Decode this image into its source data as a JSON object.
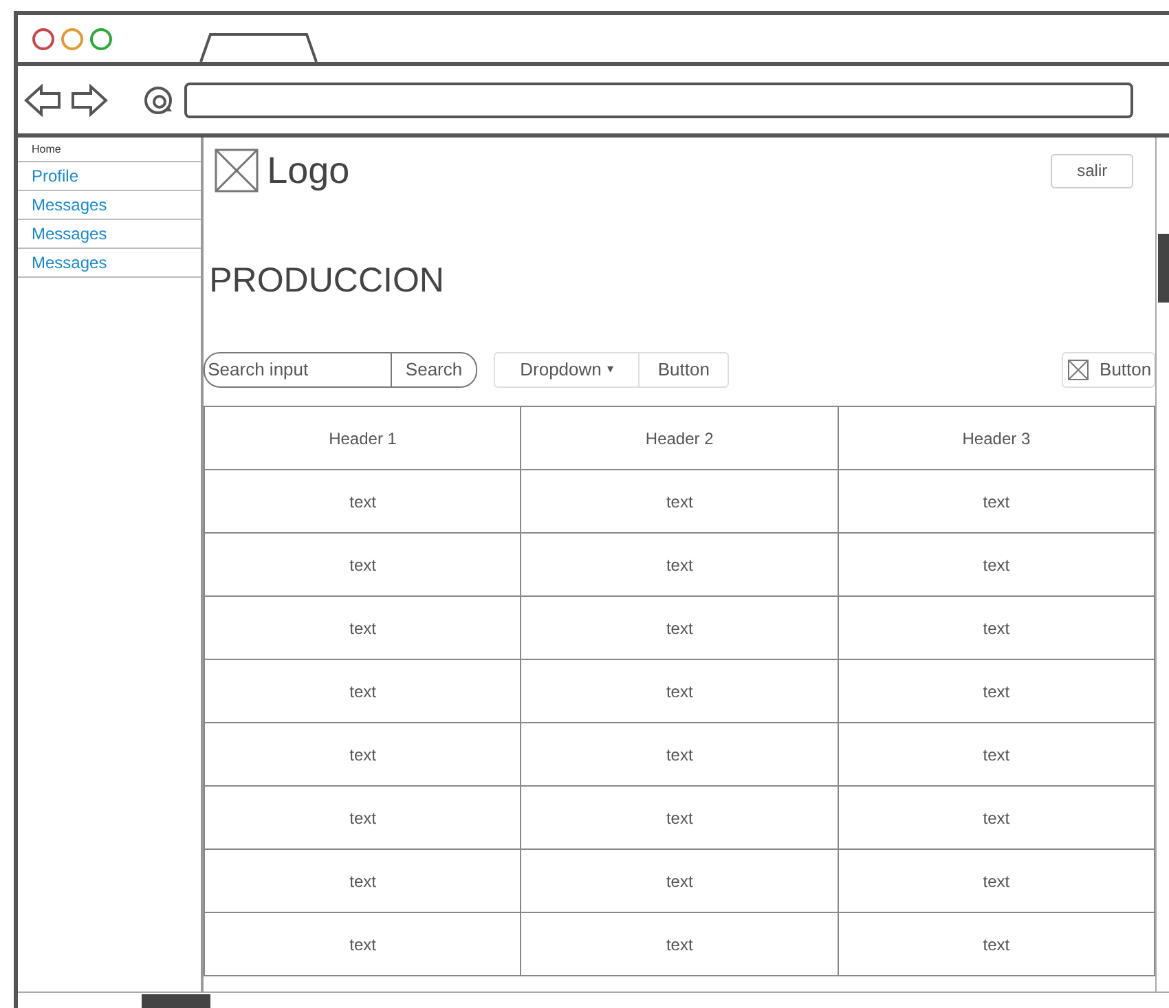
{
  "sidebar": {
    "items": [
      {
        "label": "Home",
        "kind": "header"
      },
      {
        "label": "Profile",
        "kind": "link"
      },
      {
        "label": "Messages",
        "kind": "link"
      },
      {
        "label": "Messages",
        "kind": "link"
      },
      {
        "label": "Messages",
        "kind": "link"
      }
    ]
  },
  "header": {
    "logo": "Logo",
    "exit_button": "salir"
  },
  "page_title": "PRODUCCION",
  "toolbar": {
    "search": {
      "placeholder": "Search input",
      "button": "Search"
    },
    "dropdown": "Dropdown",
    "dropdown_arrow": "▾",
    "button": "Button",
    "icon_button": "Button"
  },
  "table": {
    "columns": [
      "Header 1",
      "Header 2",
      "Header 3"
    ],
    "rows": [
      [
        "text",
        "text",
        "text"
      ],
      [
        "text",
        "text",
        "text"
      ],
      [
        "text",
        "text",
        "text"
      ],
      [
        "text",
        "text",
        "text"
      ],
      [
        "text",
        "text",
        "text"
      ],
      [
        "text",
        "text",
        "text"
      ],
      [
        "text",
        "text",
        "text"
      ],
      [
        "text",
        "text",
        "text"
      ]
    ]
  }
}
